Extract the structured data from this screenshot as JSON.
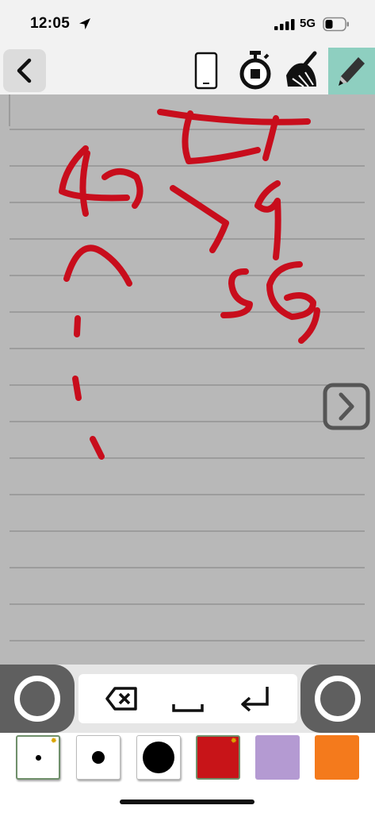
{
  "status_bar": {
    "time": "12:05",
    "network": "5G",
    "icons": [
      "location-arrow-icon",
      "signal-bars-icon",
      "battery-icon"
    ]
  },
  "toolbar": {
    "icons": [
      "chevron-left-icon",
      "phone-outline-icon",
      "stopwatch-icon",
      "broom-icon",
      "pencil-icon"
    ],
    "active_tool": "pencil",
    "active_color": "#8ecfc0"
  },
  "canvas": {
    "background": "#b8b8b8",
    "ink_color": "#c80d1c",
    "next_icon": "chevron-right-square-icon"
  },
  "keys": {
    "icons": [
      "backspace-icon",
      "space-icon",
      "return-icon"
    ]
  },
  "palette": {
    "swatches": [
      {
        "kind": "pen-small",
        "color": "#ffffff",
        "selected": true,
        "has_settings": true
      },
      {
        "kind": "pen-medium",
        "color": "#ffffff",
        "selected": false,
        "has_settings": false
      },
      {
        "kind": "pen-large",
        "color": "#ffffff",
        "selected": false,
        "has_settings": false
      },
      {
        "kind": "color",
        "color": "#c81418",
        "selected": true,
        "has_settings": true
      },
      {
        "kind": "color",
        "color": "#b49ad2",
        "selected": false,
        "has_settings": false
      },
      {
        "kind": "color",
        "color": "#f47a1c",
        "selected": false,
        "has_settings": false
      }
    ]
  }
}
